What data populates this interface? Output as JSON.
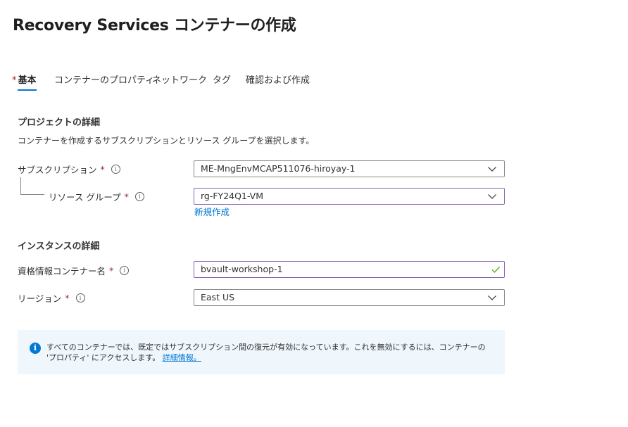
{
  "page": {
    "title": "Recovery Services コンテナーの作成",
    "more": "···"
  },
  "tabs": [
    {
      "label": "基本",
      "required": true,
      "active": true
    },
    {
      "label": "コンテナーのプロパティ"
    },
    {
      "label": "ネットワーク"
    },
    {
      "label": "タグ"
    },
    {
      "label": "確認および作成"
    }
  ],
  "project": {
    "heading": "プロジェクトの詳細",
    "description": "コンテナーを作成するサブスクリプションとリソース グループを選択します。",
    "subscription": {
      "label": "サブスクリプション",
      "value": "ME-MngEnvMCAP511076-hiroyay-1"
    },
    "resource_group": {
      "label": "リソース グループ",
      "value": "rg-FY24Q1-VM",
      "create_new_link": "新規作成"
    }
  },
  "instance": {
    "heading": "インスタンスの詳細",
    "vault_name": {
      "label": "資格情報コンテナー名",
      "value": "bvault-workshop-1"
    },
    "region": {
      "label": "リージョン",
      "value": "East US"
    }
  },
  "required_marker": "*",
  "info_banner": {
    "text": "すべてのコンテナーでは、既定ではサブスクリプション間の復元が有効になっています。これを無効にするには、コンテナーの 'プロパティ' にアクセスします。",
    "link": "詳細情報。"
  },
  "colors": {
    "accent": "#0078d4",
    "required": "#a4262c",
    "valid": "#57a300",
    "focus": "#8764b8",
    "banner_bg": "#eff6fc"
  },
  "icons": {
    "dropdown": "chevron-down-icon",
    "valid": "checkmark-icon",
    "info": "info-icon"
  }
}
